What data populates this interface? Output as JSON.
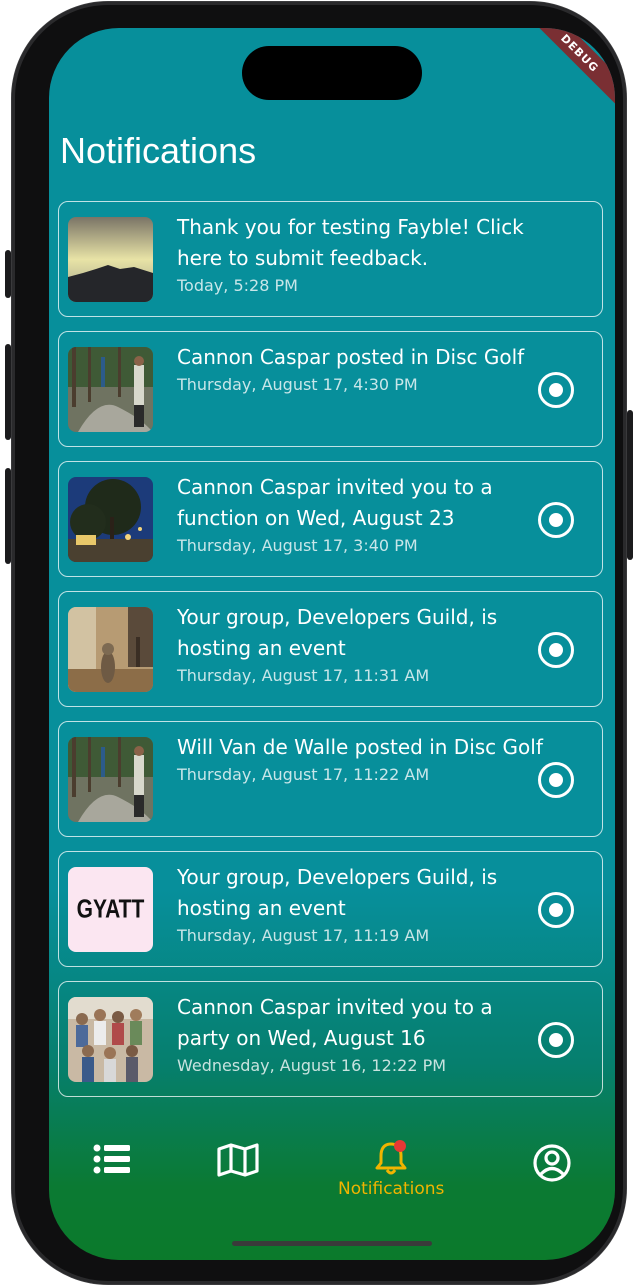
{
  "header": {
    "title": "Notifications"
  },
  "debug_banner": "DEBUG",
  "notifications": [
    {
      "message": "Thank you for testing Fayble! Click here to submit feedback.",
      "time": "Today, 5:28 PM",
      "thumbnail": "sunset-hill-photo",
      "unread": false
    },
    {
      "message": "Cannon Caspar posted in Disc Golf",
      "time": "Thursday, August 17, 4:30 PM",
      "thumbnail": "disc-golf-photo",
      "unread": true
    },
    {
      "message": "Cannon Caspar invited you to a function on Wed, August 23",
      "time": "Thursday, August 17, 3:40 PM",
      "thumbnail": "night-trees-photo",
      "unread": true
    },
    {
      "message": "Your group, Developers Guild, is hosting an event",
      "time": "Thursday, August 17, 11:31 AM",
      "thumbnail": "cat-hallway-photo",
      "unread": true
    },
    {
      "message": "Will Van de Walle posted in Disc Golf",
      "time": "Thursday, August 17, 11:22 AM",
      "thumbnail": "disc-golf-photo",
      "unread": true
    },
    {
      "message": "Your group, Developers Guild, is hosting an event",
      "time": "Thursday, August 17, 11:19 AM",
      "thumbnail": "gyatt-logo",
      "thumbnail_text": "GYATT",
      "unread": true
    },
    {
      "message": "Cannon Caspar invited you to a party on Wed, August 16",
      "time": "Wednesday, August 16, 12:22 PM",
      "thumbnail": "group-photo",
      "unread": true
    }
  ],
  "bottom_nav": {
    "items": [
      {
        "name": "list",
        "icon": "list-icon",
        "label": ""
      },
      {
        "name": "map",
        "icon": "map-icon",
        "label": ""
      },
      {
        "name": "notifications",
        "icon": "bell-icon",
        "label": "Notifications",
        "active": true,
        "badge_dot": true
      },
      {
        "name": "profile",
        "icon": "account-circle-icon",
        "label": ""
      }
    ]
  },
  "colors": {
    "background_top": "#078f9b",
    "background_bottom": "#0b7a2b",
    "active_nav": "#f0b400",
    "badge": "#e53935"
  }
}
